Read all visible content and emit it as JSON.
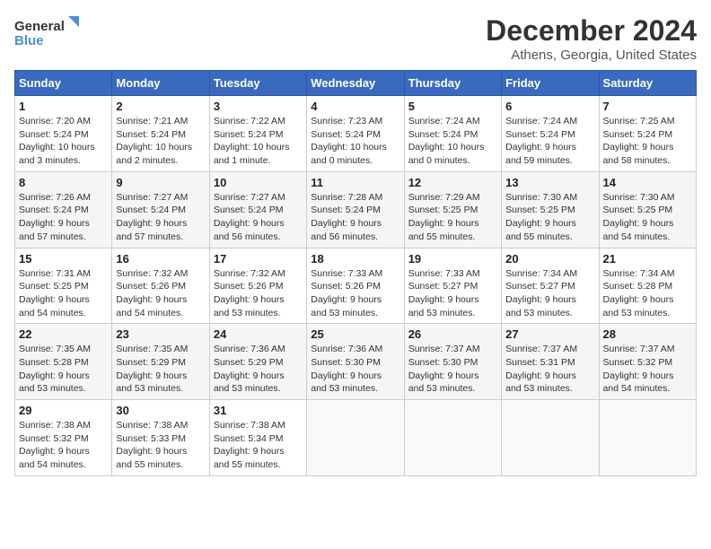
{
  "logo": {
    "line1": "General",
    "line2": "Blue"
  },
  "title": "December 2024",
  "subtitle": "Athens, Georgia, United States",
  "days_of_week": [
    "Sunday",
    "Monday",
    "Tuesday",
    "Wednesday",
    "Thursday",
    "Friday",
    "Saturday"
  ],
  "weeks": [
    [
      {
        "day": 1,
        "sunrise": "7:20 AM",
        "sunset": "5:24 PM",
        "daylight": "10 hours and 3 minutes."
      },
      {
        "day": 2,
        "sunrise": "7:21 AM",
        "sunset": "5:24 PM",
        "daylight": "10 hours and 2 minutes."
      },
      {
        "day": 3,
        "sunrise": "7:22 AM",
        "sunset": "5:24 PM",
        "daylight": "10 hours and 1 minute."
      },
      {
        "day": 4,
        "sunrise": "7:23 AM",
        "sunset": "5:24 PM",
        "daylight": "10 hours and 0 minutes."
      },
      {
        "day": 5,
        "sunrise": "7:24 AM",
        "sunset": "5:24 PM",
        "daylight": "10 hours and 0 minutes."
      },
      {
        "day": 6,
        "sunrise": "7:24 AM",
        "sunset": "5:24 PM",
        "daylight": "9 hours and 59 minutes."
      },
      {
        "day": 7,
        "sunrise": "7:25 AM",
        "sunset": "5:24 PM",
        "daylight": "9 hours and 58 minutes."
      }
    ],
    [
      {
        "day": 8,
        "sunrise": "7:26 AM",
        "sunset": "5:24 PM",
        "daylight": "9 hours and 57 minutes."
      },
      {
        "day": 9,
        "sunrise": "7:27 AM",
        "sunset": "5:24 PM",
        "daylight": "9 hours and 57 minutes."
      },
      {
        "day": 10,
        "sunrise": "7:27 AM",
        "sunset": "5:24 PM",
        "daylight": "9 hours and 56 minutes."
      },
      {
        "day": 11,
        "sunrise": "7:28 AM",
        "sunset": "5:24 PM",
        "daylight": "9 hours and 56 minutes."
      },
      {
        "day": 12,
        "sunrise": "7:29 AM",
        "sunset": "5:25 PM",
        "daylight": "9 hours and 55 minutes."
      },
      {
        "day": 13,
        "sunrise": "7:30 AM",
        "sunset": "5:25 PM",
        "daylight": "9 hours and 55 minutes."
      },
      {
        "day": 14,
        "sunrise": "7:30 AM",
        "sunset": "5:25 PM",
        "daylight": "9 hours and 54 minutes."
      }
    ],
    [
      {
        "day": 15,
        "sunrise": "7:31 AM",
        "sunset": "5:25 PM",
        "daylight": "9 hours and 54 minutes."
      },
      {
        "day": 16,
        "sunrise": "7:32 AM",
        "sunset": "5:26 PM",
        "daylight": "9 hours and 54 minutes."
      },
      {
        "day": 17,
        "sunrise": "7:32 AM",
        "sunset": "5:26 PM",
        "daylight": "9 hours and 53 minutes."
      },
      {
        "day": 18,
        "sunrise": "7:33 AM",
        "sunset": "5:26 PM",
        "daylight": "9 hours and 53 minutes."
      },
      {
        "day": 19,
        "sunrise": "7:33 AM",
        "sunset": "5:27 PM",
        "daylight": "9 hours and 53 minutes."
      },
      {
        "day": 20,
        "sunrise": "7:34 AM",
        "sunset": "5:27 PM",
        "daylight": "9 hours and 53 minutes."
      },
      {
        "day": 21,
        "sunrise": "7:34 AM",
        "sunset": "5:28 PM",
        "daylight": "9 hours and 53 minutes."
      }
    ],
    [
      {
        "day": 22,
        "sunrise": "7:35 AM",
        "sunset": "5:28 PM",
        "daylight": "9 hours and 53 minutes."
      },
      {
        "day": 23,
        "sunrise": "7:35 AM",
        "sunset": "5:29 PM",
        "daylight": "9 hours and 53 minutes."
      },
      {
        "day": 24,
        "sunrise": "7:36 AM",
        "sunset": "5:29 PM",
        "daylight": "9 hours and 53 minutes."
      },
      {
        "day": 25,
        "sunrise": "7:36 AM",
        "sunset": "5:30 PM",
        "daylight": "9 hours and 53 minutes."
      },
      {
        "day": 26,
        "sunrise": "7:37 AM",
        "sunset": "5:30 PM",
        "daylight": "9 hours and 53 minutes."
      },
      {
        "day": 27,
        "sunrise": "7:37 AM",
        "sunset": "5:31 PM",
        "daylight": "9 hours and 53 minutes."
      },
      {
        "day": 28,
        "sunrise": "7:37 AM",
        "sunset": "5:32 PM",
        "daylight": "9 hours and 54 minutes."
      }
    ],
    [
      {
        "day": 29,
        "sunrise": "7:38 AM",
        "sunset": "5:32 PM",
        "daylight": "9 hours and 54 minutes."
      },
      {
        "day": 30,
        "sunrise": "7:38 AM",
        "sunset": "5:33 PM",
        "daylight": "9 hours and 55 minutes."
      },
      {
        "day": 31,
        "sunrise": "7:38 AM",
        "sunset": "5:34 PM",
        "daylight": "9 hours and 55 minutes."
      },
      null,
      null,
      null,
      null
    ]
  ]
}
